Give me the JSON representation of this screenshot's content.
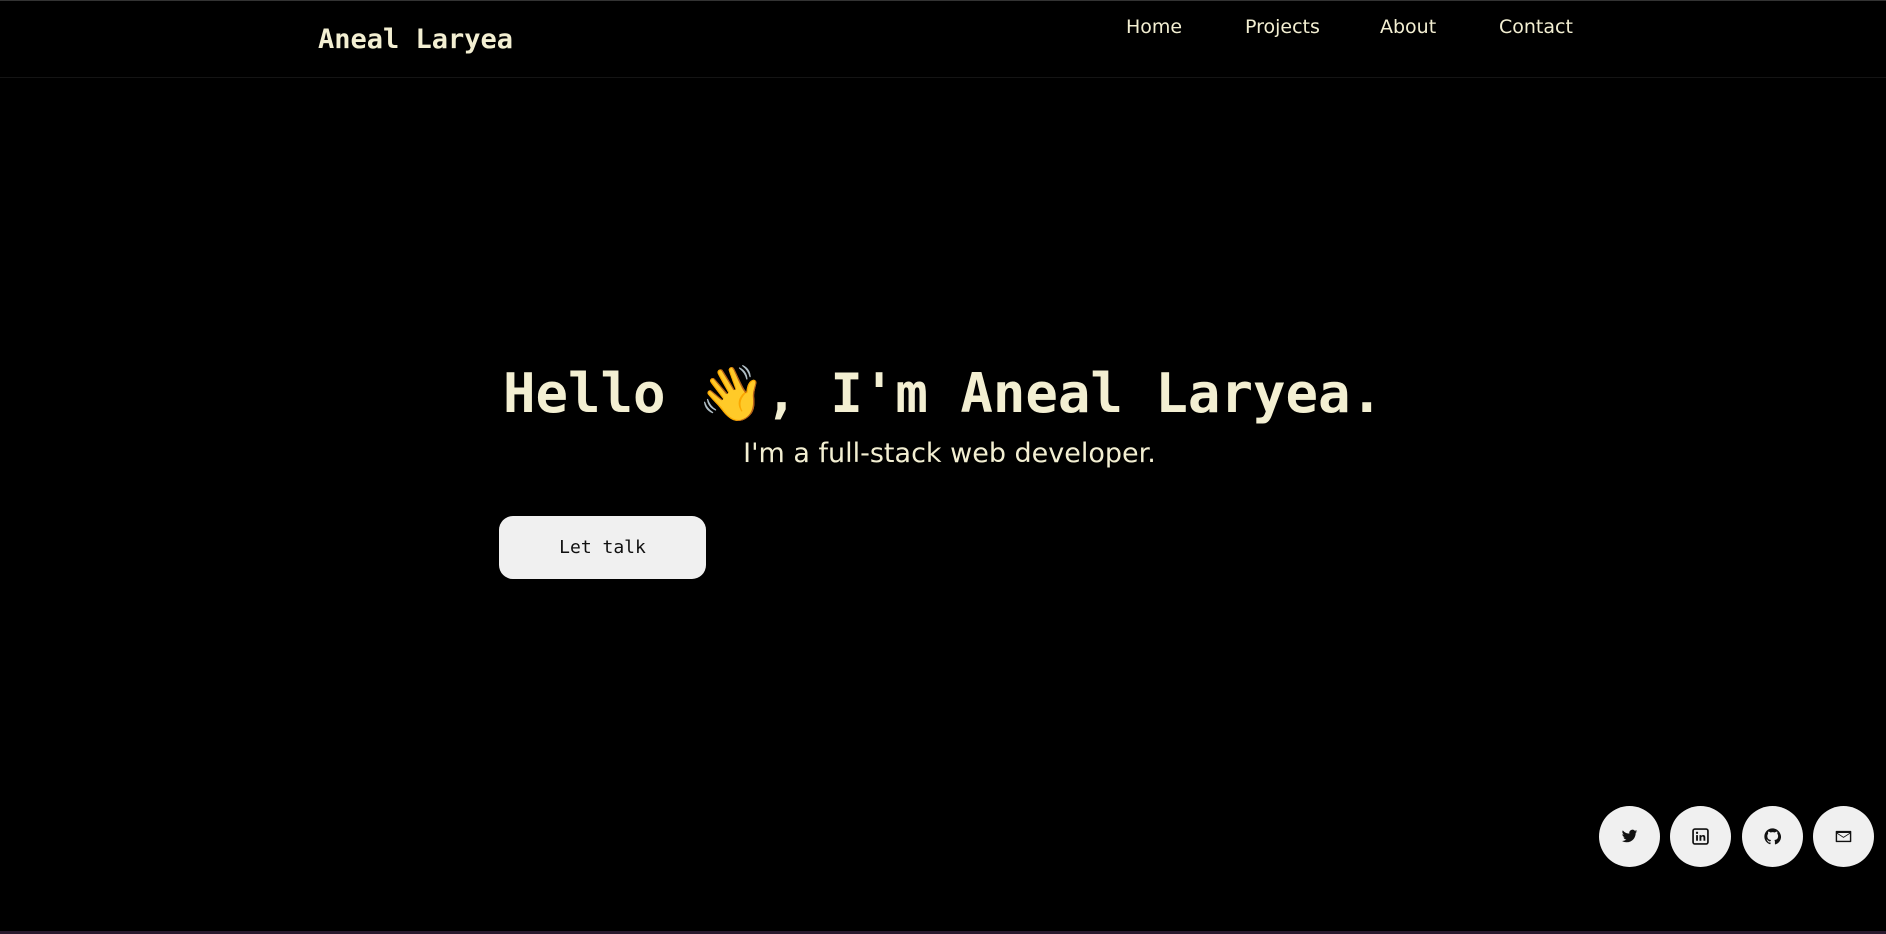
{
  "header": {
    "brand": "Aneal Laryea",
    "nav": [
      {
        "label": "Home"
      },
      {
        "label": "Projects"
      },
      {
        "label": "About"
      },
      {
        "label": "Contact"
      }
    ]
  },
  "hero": {
    "greeting": "Hello ",
    "wave_emoji": "👋",
    "title_rest": ", I'm Aneal Laryea.",
    "subtitle": "I'm a full-stack web developer.",
    "cta_label": "Let talk"
  },
  "social": [
    {
      "icon": "twitter-icon"
    },
    {
      "icon": "linkedin-icon"
    },
    {
      "icon": "github-icon"
    },
    {
      "icon": "mail-icon"
    }
  ],
  "colors": {
    "background": "#000000",
    "text": "#f3efd2",
    "button_bg": "#f0f0f0",
    "button_text": "#111111"
  }
}
